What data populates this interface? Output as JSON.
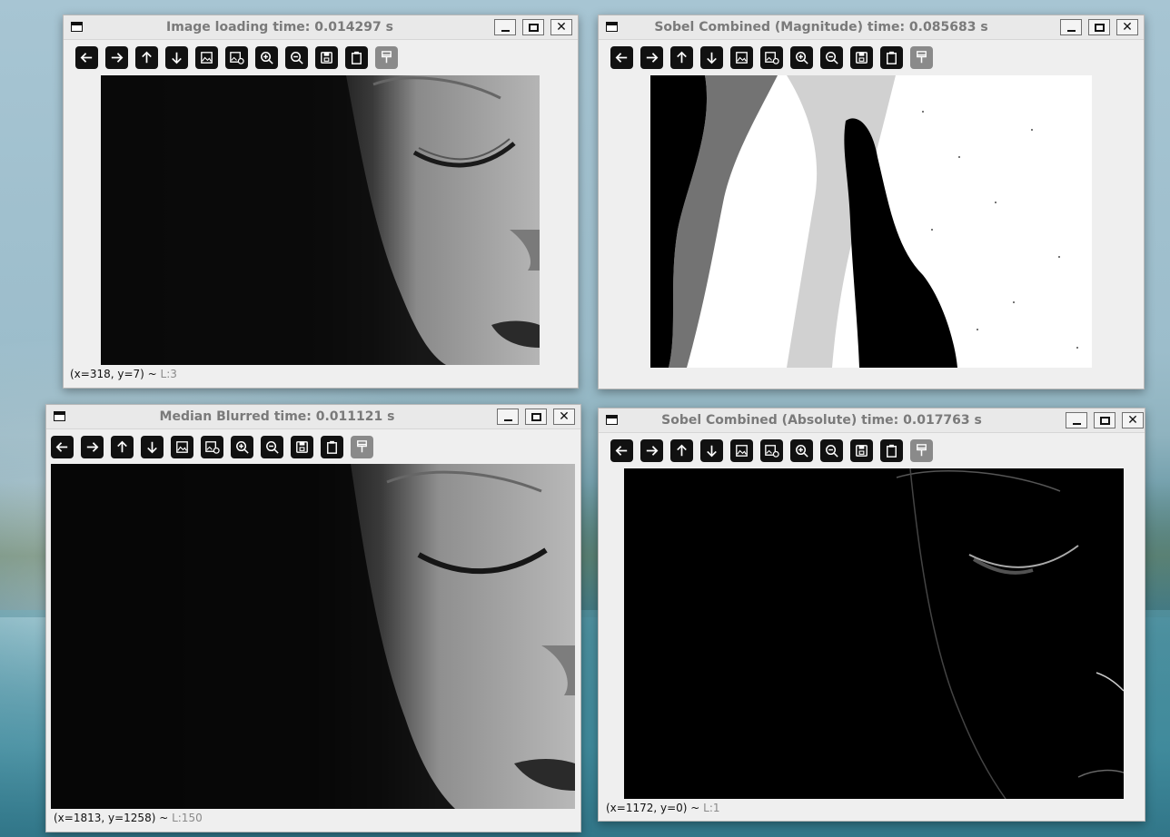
{
  "windows": [
    {
      "id": "original",
      "title": "Image loading time: 0.014297 s",
      "status_coords": "(x=318, y=7) ~ ",
      "status_level": "L:3"
    },
    {
      "id": "sobel-magnitude",
      "title": "Sobel Combined (Magnitude) time: 0.085683 s",
      "status_coords": "",
      "status_level": ""
    },
    {
      "id": "median-blurred",
      "title": "Median Blurred time: 0.011121 s",
      "status_coords": "(x=1813, y=1258) ~ ",
      "status_level": "L:150"
    },
    {
      "id": "sobel-absolute",
      "title": "Sobel Combined (Absolute) time: 0.017763 s",
      "status_coords": "(x=1172, y=0) ~ ",
      "status_level": "L:1"
    }
  ],
  "toolbar_icons": [
    "arrow-left-icon",
    "arrow-right-icon",
    "arrow-up-icon",
    "arrow-down-icon",
    "image-icon",
    "image-settings-icon",
    "zoom-in-icon",
    "zoom-out-icon",
    "save-icon",
    "clipboard-icon",
    "paint-brush-icon"
  ],
  "colors": {
    "title_text": "#7a7a7a",
    "toolbar_button": "#111111",
    "toolbar_button_disabled": "#8a8a8a",
    "window_bg": "#efefef"
  }
}
